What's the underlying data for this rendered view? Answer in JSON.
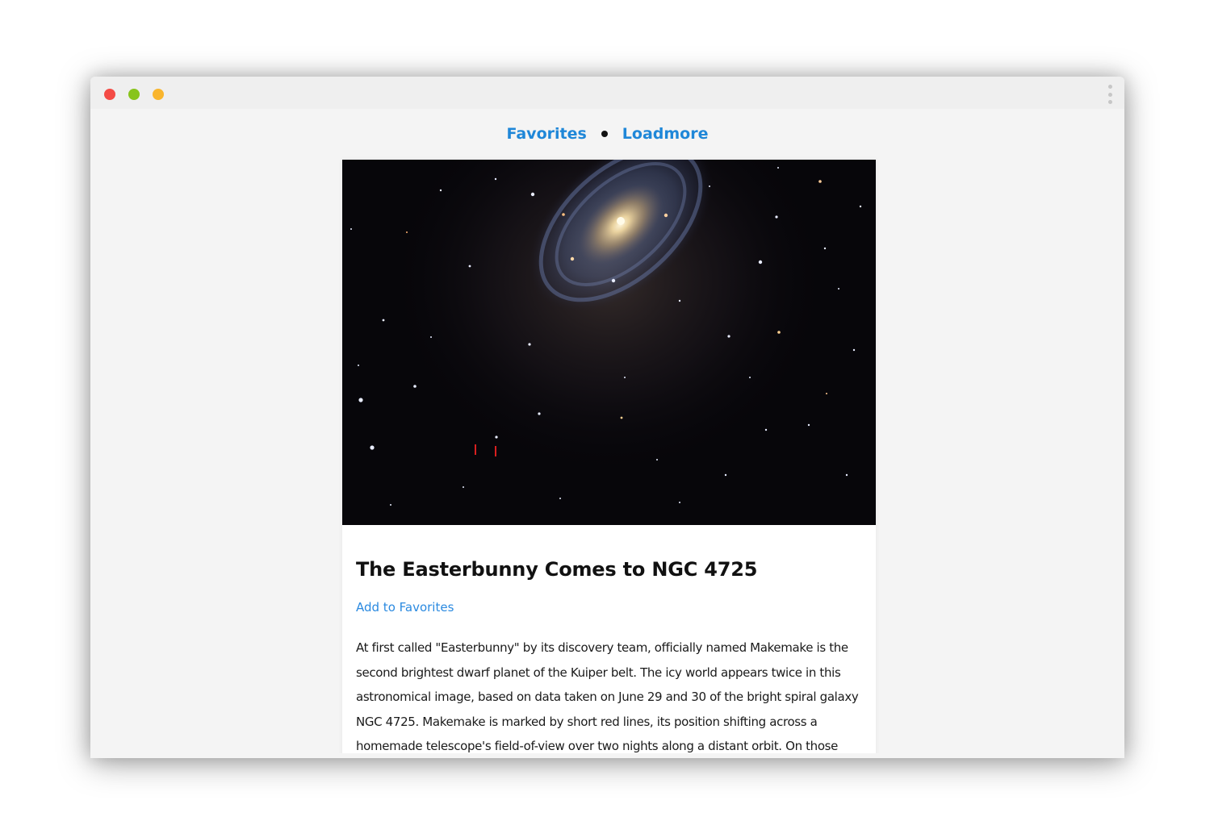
{
  "window": {
    "menu_icon": "kebab-menu-icon"
  },
  "nav": {
    "favorites_label": "Favorites",
    "loadmore_label": "Loadmore"
  },
  "card": {
    "image_alt": "Galaxy NGC 4725 with dwarf planet Makemake",
    "title": "The Easterbunny Comes to NGC 4725",
    "add_favorites_label": "Add to Favorites",
    "explanation": "At first called \"Easterbunny\" by its discovery team, officially named Makemake is the second brightest dwarf planet of the Kuiper belt. The icy world appears twice in this astronomical image, based on data taken on June 29 and 30 of the bright spiral galaxy NGC 4725. Makemake is marked by short red lines, its position shifting across a homemade telescope's field-of-view over two nights along a distant orbit. On those dates"
  },
  "colors": {
    "link": "#1f87d8",
    "page_bg": "#f4f4f4",
    "card_bg": "#ffffff",
    "dot_red": "#f44b45",
    "dot_green": "#88c41b",
    "dot_yellow": "#f9b52d"
  }
}
